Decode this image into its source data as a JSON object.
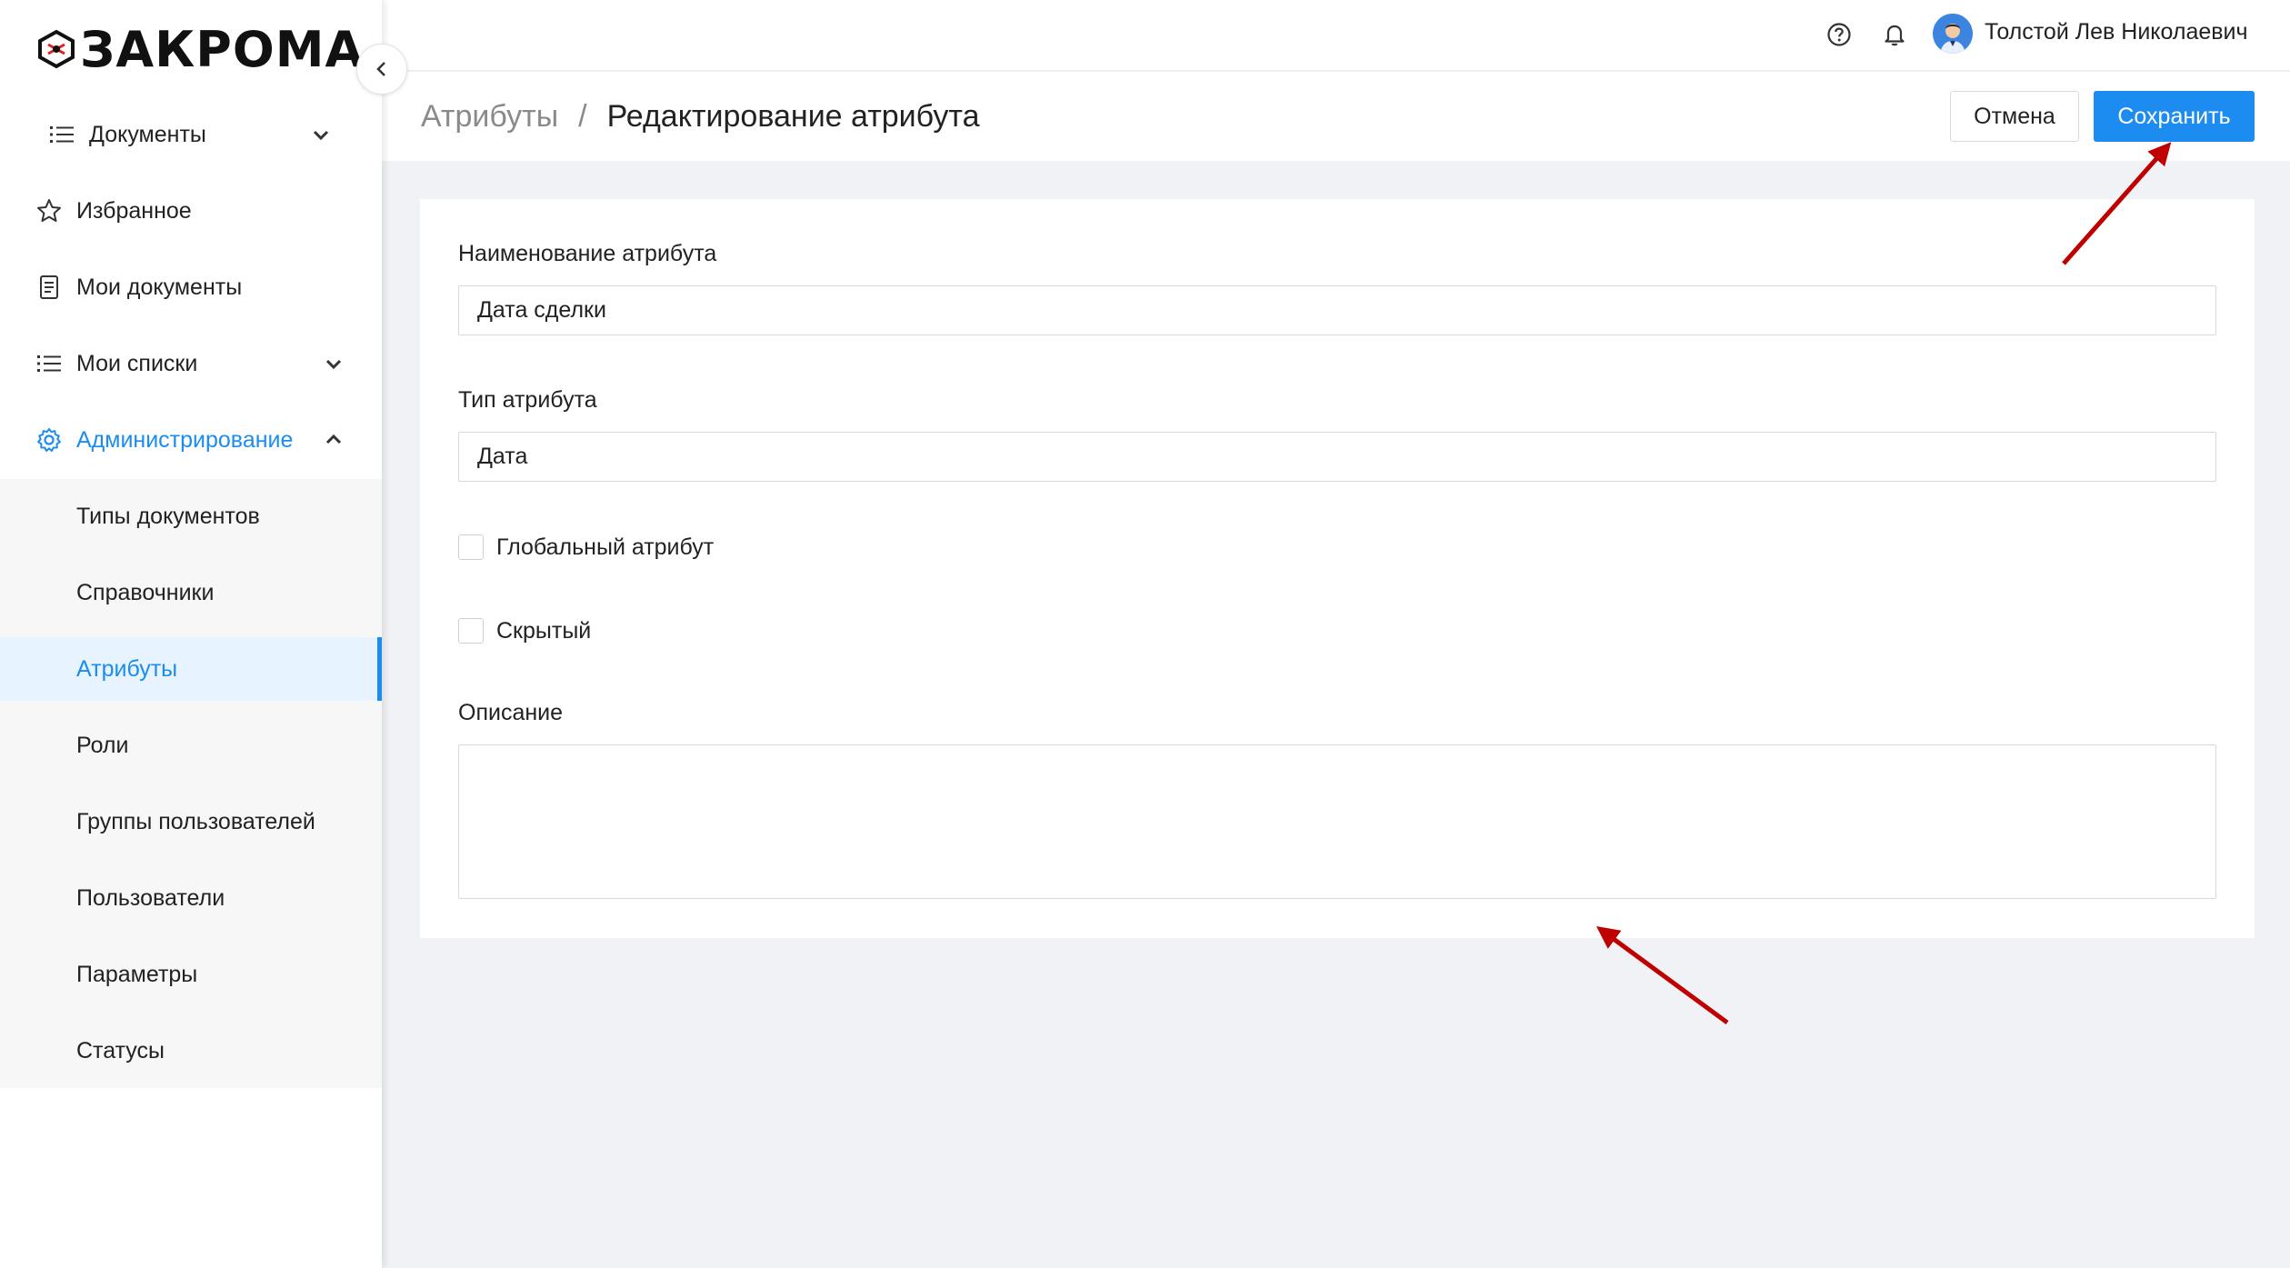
{
  "app": {
    "logo_text": "ЗАКРОМА"
  },
  "sidebar": {
    "items": [
      {
        "label": "Документы",
        "icon": "list-icon"
      },
      {
        "label": "Избранное",
        "icon": "star-icon"
      },
      {
        "label": "Мои документы",
        "icon": "document-icon"
      },
      {
        "label": "Мои списки",
        "icon": "list-icon"
      },
      {
        "label": "Администрирование",
        "icon": "gear-icon"
      }
    ],
    "admin_subitems": [
      {
        "label": "Типы документов"
      },
      {
        "label": "Справочники"
      },
      {
        "label": "Атрибуты"
      },
      {
        "label": "Роли"
      },
      {
        "label": "Группы пользователей"
      },
      {
        "label": "Пользователи"
      },
      {
        "label": "Параметры"
      },
      {
        "label": "Статусы"
      }
    ],
    "selected_subitem": "Атрибуты",
    "accent_color": "#1c8cf0"
  },
  "header": {
    "user_name": "Толстой Лев Николаевич",
    "icons": [
      "help-icon",
      "bell-icon"
    ]
  },
  "page": {
    "breadcrumb_parent": "Атрибуты",
    "breadcrumb_separator": "/",
    "title": "Редактирование атрибута",
    "cancel_label": "Отмена",
    "save_label": "Сохранить"
  },
  "form": {
    "name_label": "Наименование атрибута",
    "name_value": "Дата сделки",
    "type_label": "Тип атрибута",
    "type_value": "Дата",
    "global_label": "Глобальный атрибут",
    "global_checked": false,
    "hidden_label": "Скрытый",
    "hidden_checked": false,
    "description_label": "Описание",
    "description_value": ""
  },
  "annotations": {
    "arrow_color": "#c00000"
  }
}
